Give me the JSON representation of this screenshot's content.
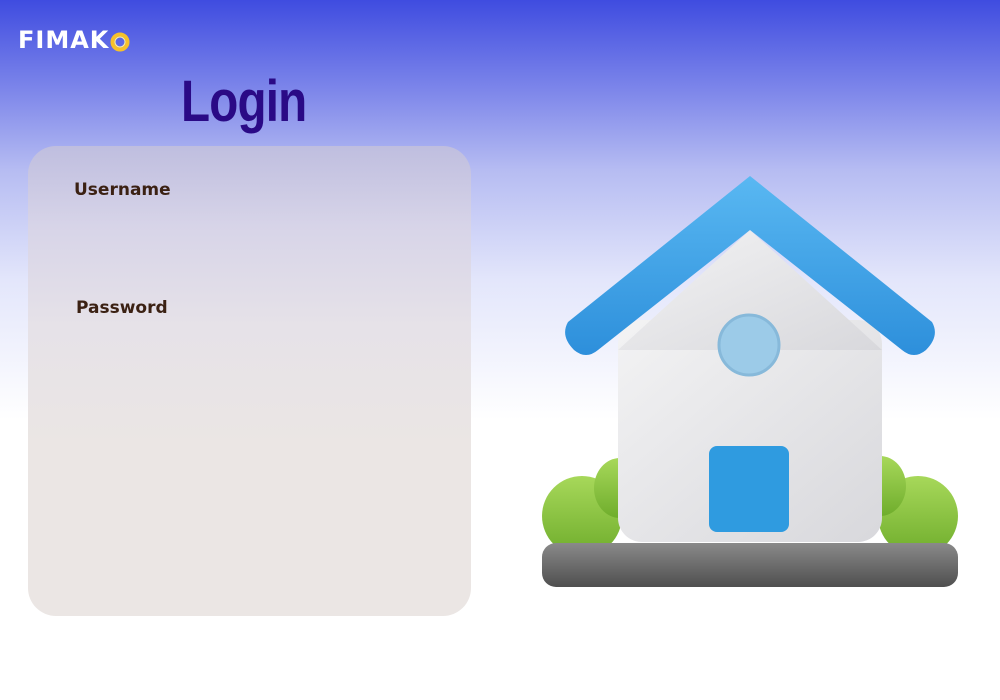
{
  "brand": {
    "name_prefix": "FIMAK",
    "logo_mark": "O",
    "ring_color": "#f6c12a"
  },
  "page": {
    "title": "Login",
    "title_color": "#2a0a86"
  },
  "form": {
    "username_label": "Username",
    "username_value": "",
    "username_placeholder": "",
    "password_label": "Password",
    "password_value": "",
    "password_placeholder": ""
  },
  "illustration": {
    "icon": "house-icon",
    "roof_color": "#3ea3e8",
    "door_color": "#2f9be0",
    "bush_color": "#8cc63f",
    "base_color": "#6d6d6d"
  }
}
